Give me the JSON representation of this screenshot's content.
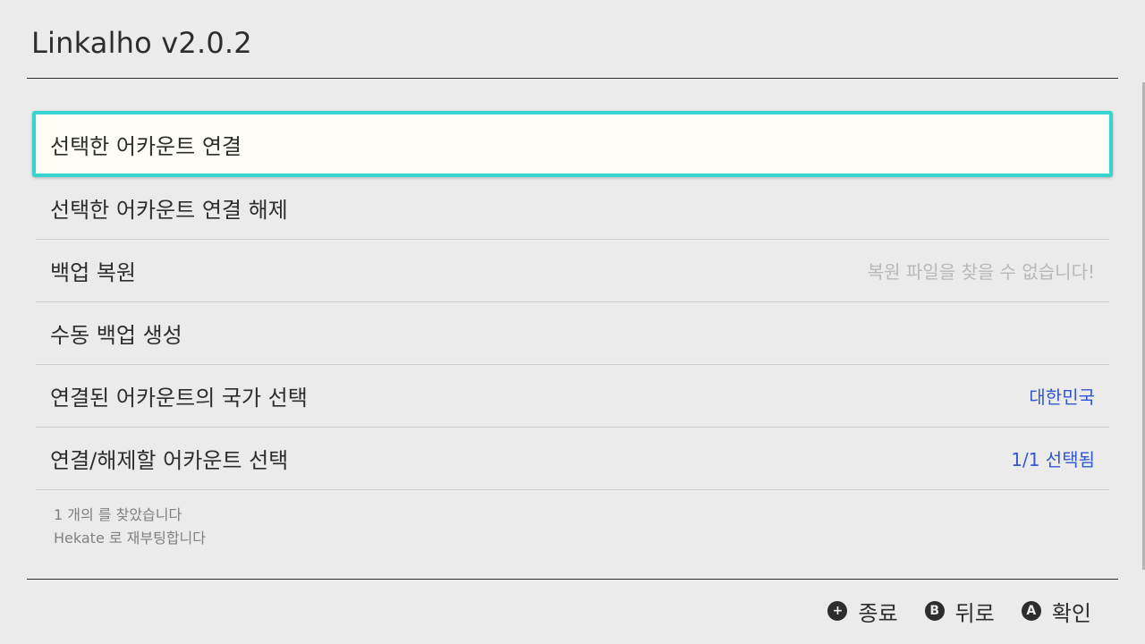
{
  "app": {
    "title": "Linkalho v2.0.2"
  },
  "menu": {
    "items": [
      {
        "label": "선택한 어카운트 연결",
        "value": ""
      },
      {
        "label": "선택한 어카운트 연결 해제",
        "value": ""
      },
      {
        "label": "백업 복원",
        "value": "복원 파일을 찾을 수 없습니다!"
      },
      {
        "label": "수동 백업 생성",
        "value": ""
      },
      {
        "label": "연결된 어카운트의 국가 선택",
        "value": "대한민국"
      },
      {
        "label": "연결/해제할 어카운트 선택",
        "value": "1/1 선택됨"
      }
    ]
  },
  "info": {
    "line1": "1 개의 를 찾았습니다",
    "line2": "Hekate 로 재부팅합니다"
  },
  "footer": {
    "hints": [
      {
        "icon": "+",
        "icon_name": "plus-button-icon",
        "label": "종료"
      },
      {
        "icon": "B",
        "icon_name": "b-button-icon",
        "label": "뒤로"
      },
      {
        "icon": "A",
        "icon_name": "a-button-icon",
        "label": "확인"
      }
    ]
  },
  "colors": {
    "background": "#ebebeb",
    "selection_border": "#36d3cf",
    "selection_fill": "#fdfdf6",
    "accent_value": "#3357d1",
    "disabled_value": "#b8b8b8"
  }
}
